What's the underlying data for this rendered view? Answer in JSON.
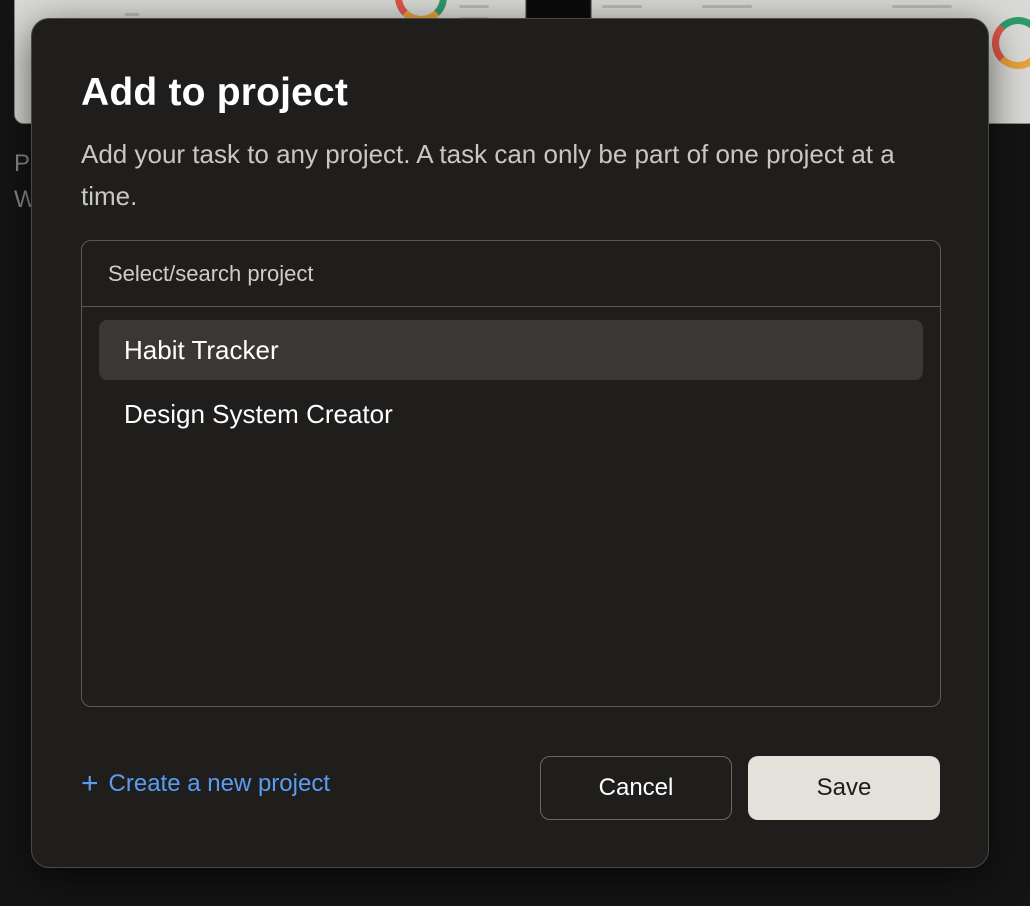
{
  "modal": {
    "title": "Add to project",
    "description": "Add your task to any project. A task can only be part of one project at a time.",
    "search": {
      "placeholder": "Select/search project",
      "value": ""
    },
    "projects": [
      {
        "label": "Habit Tracker",
        "active": true
      },
      {
        "label": "Design System Creator",
        "active": false
      }
    ],
    "create_link": {
      "icon": "plus-icon",
      "label": "Create a new project"
    },
    "buttons": {
      "cancel": "Cancel",
      "save": "Save"
    }
  },
  "background": {
    "letters": [
      "P",
      "W"
    ]
  },
  "colors": {
    "accent_link": "#5a9cf0",
    "save_button_bg": "#e4e1da",
    "modal_bg": "#1f1e1d",
    "active_item_bg": "#3a3734"
  }
}
